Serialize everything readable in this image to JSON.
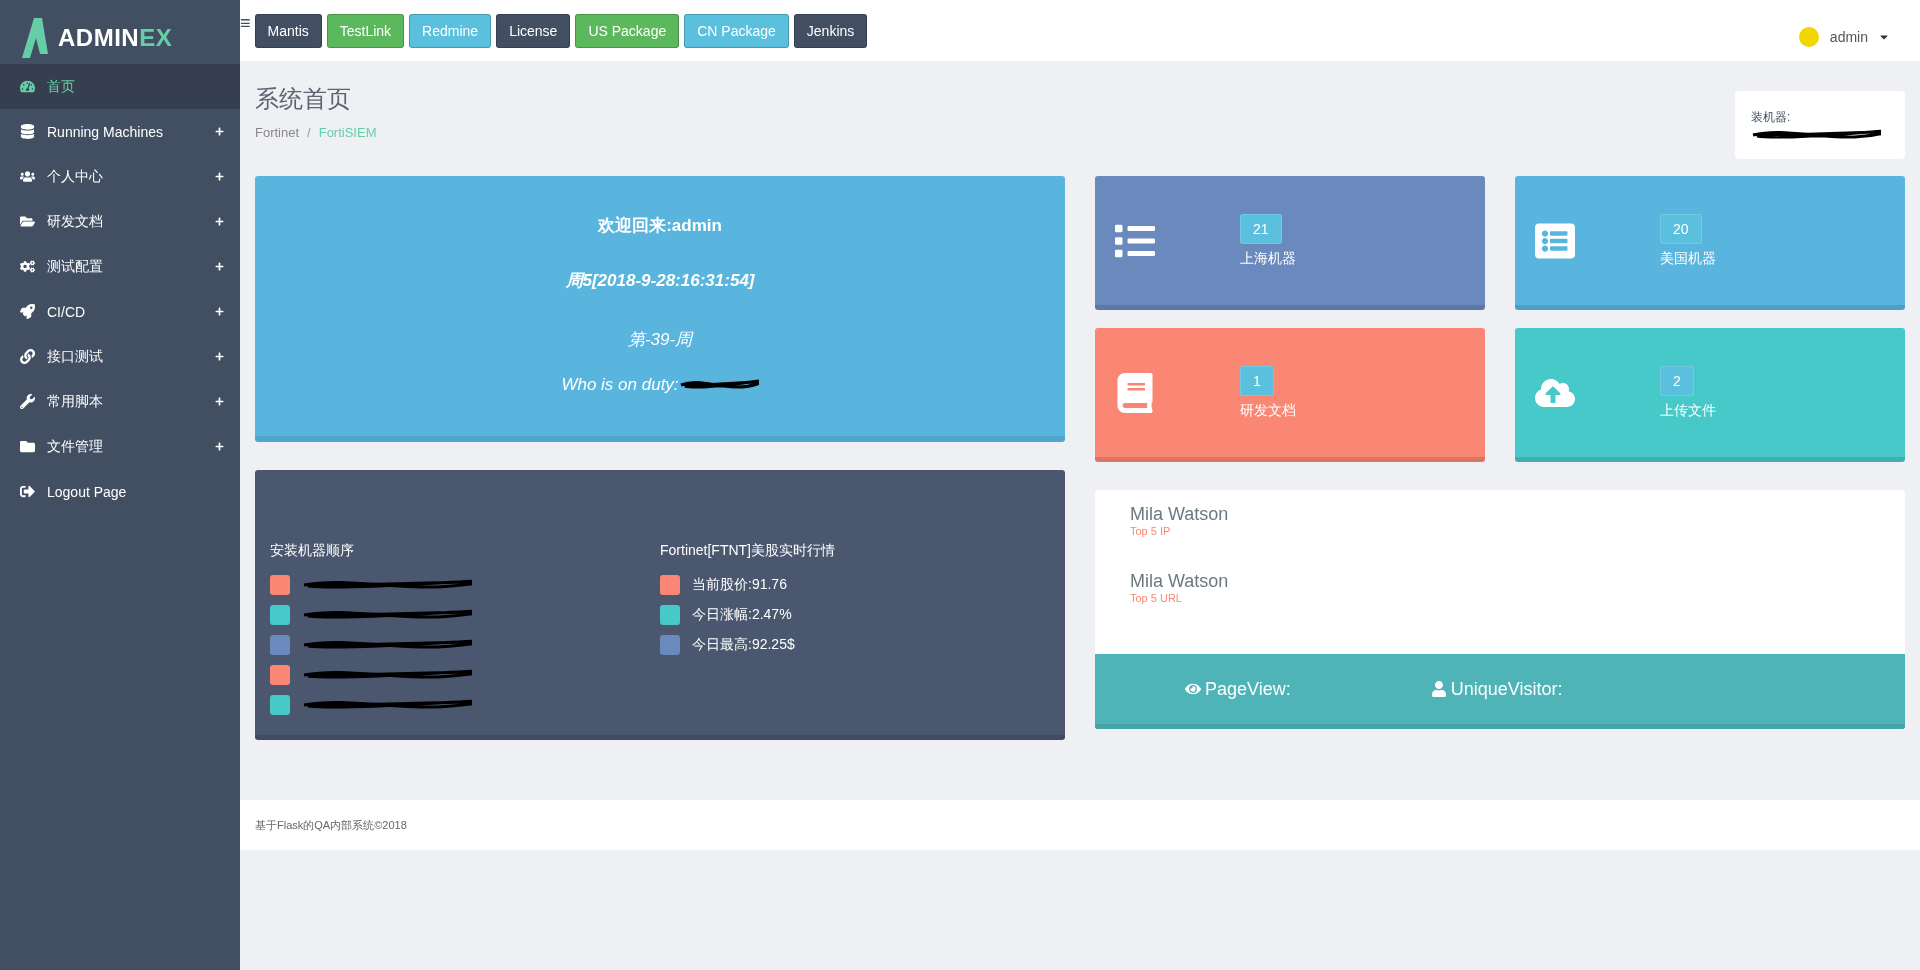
{
  "sidebar": {
    "logo": {
      "main": "ADMIN",
      "accent": "EX"
    },
    "items": [
      {
        "label": "首页",
        "selected": true,
        "expandable": false
      },
      {
        "label": "Running Machines",
        "selected": false,
        "expandable": true
      },
      {
        "label": "个人中心",
        "selected": false,
        "expandable": true
      },
      {
        "label": "研发文档",
        "selected": false,
        "expandable": true
      },
      {
        "label": "测试配置",
        "selected": false,
        "expandable": true
      },
      {
        "label": "CI/CD",
        "selected": false,
        "expandable": true
      },
      {
        "label": "接口测试",
        "selected": false,
        "expandable": true
      },
      {
        "label": "常用脚本",
        "selected": false,
        "expandable": true
      },
      {
        "label": "文件管理",
        "selected": false,
        "expandable": true
      },
      {
        "label": "Logout Page",
        "selected": false,
        "expandable": false
      }
    ]
  },
  "topbar": {
    "menu_icon": "≡",
    "buttons": [
      {
        "label": "Mantis",
        "kind": "dark"
      },
      {
        "label": "TestLink",
        "kind": "green"
      },
      {
        "label": "Redmine",
        "kind": "info"
      },
      {
        "label": "License",
        "kind": "dark"
      },
      {
        "label": "US Package",
        "kind": "green"
      },
      {
        "label": "CN Package",
        "kind": "info"
      },
      {
        "label": "Jenkins",
        "kind": "dark"
      }
    ],
    "user": "admin"
  },
  "page": {
    "title": "系统首页",
    "breadcrumb_separator": "/",
    "breadcrumb": [
      {
        "label": "Fortinet",
        "selected": false
      },
      {
        "label": "FortiSIEM",
        "selected": true
      }
    ],
    "installer_label": "装机器:"
  },
  "welcome": {
    "lines": [
      {
        "text": "欢迎回来:admin",
        "kind": "bold"
      },
      {
        "text": "周5[2018-9-28:16:31:54]",
        "kind": "bold-italic"
      },
      {
        "text": "第-39-周",
        "kind": "italic"
      },
      {
        "text": "Who is on duty:",
        "kind": "italic-redacted"
      }
    ]
  },
  "install_order": {
    "title": "安装机器顺序",
    "items": [
      {
        "color": "#fa8774"
      },
      {
        "color": "#48c9c9"
      },
      {
        "color": "#6a89bd"
      },
      {
        "color": "#fa8774"
      },
      {
        "color": "#48c9c9"
      }
    ]
  },
  "stock": {
    "title": "Fortinet[FTNT]美股实时行情",
    "items": [
      {
        "text": "当前股价:91.76",
        "color": "#fa8774"
      },
      {
        "text": "今日涨幅:2.47%",
        "color": "#48c9c9"
      },
      {
        "text": "今日最高:92.25$",
        "color": "#6a89bd"
      }
    ]
  },
  "tiles": [
    {
      "count": "21",
      "label": "上海机器",
      "color": "#6a89bd"
    },
    {
      "count": "20",
      "label": "美国机器",
      "color": "#5ab5de"
    },
    {
      "count": "1",
      "label": "研发文档",
      "color": "#fa8774"
    },
    {
      "count": "2",
      "label": "上传文件",
      "color": "#48c9c9"
    }
  ],
  "top5": [
    {
      "name": "Mila Watson",
      "caption": "Top 5 IP"
    },
    {
      "name": "Mila Watson",
      "caption": "Top 5 URL"
    }
  ],
  "visits": [
    {
      "label": "PageView:"
    },
    {
      "label": "UniqueVisitor:"
    }
  ],
  "footer": "基于Flask的QA内部系统©2018"
}
